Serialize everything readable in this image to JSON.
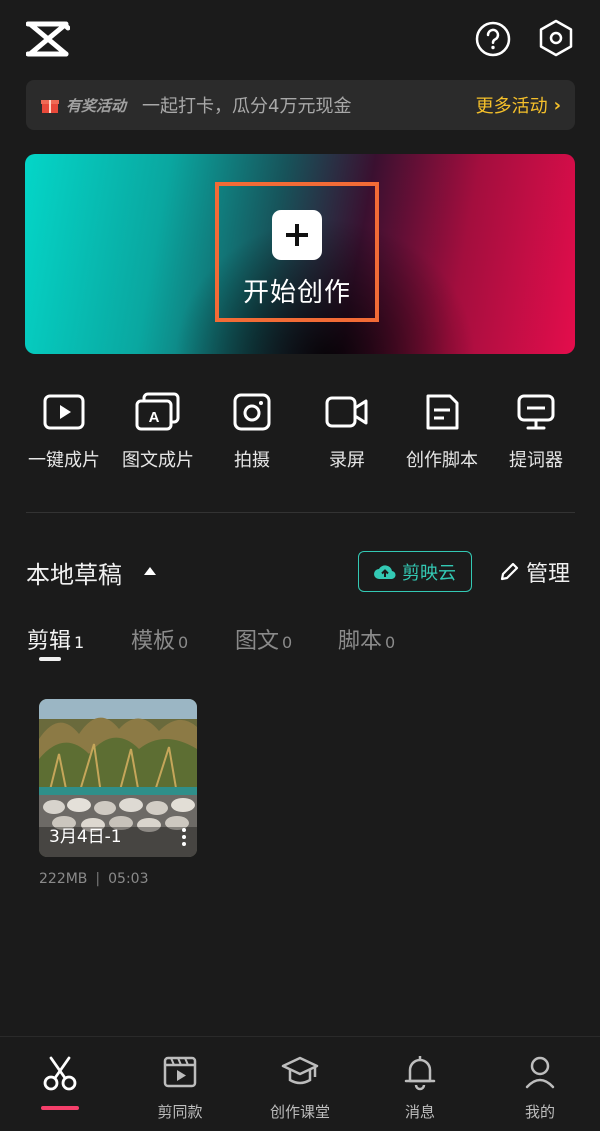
{
  "app": {
    "logo_icon": "capcut-logo-icon",
    "help_icon": "help-icon",
    "settings_icon": "settings-hex-icon"
  },
  "promo": {
    "tag": "有奖活动",
    "text": "一起打卡，瓜分4万元现金",
    "more_label": "更多活动",
    "more_color": "#f5c02a"
  },
  "create": {
    "label": "开始创作",
    "highlight_color": "#f26b36"
  },
  "tools": [
    {
      "label": "一键成片",
      "icon": "play-square-icon"
    },
    {
      "label": "图文成片",
      "icon": "text-card-icon"
    },
    {
      "label": "拍摄",
      "icon": "camera-icon"
    },
    {
      "label": "录屏",
      "icon": "video-camera-icon"
    },
    {
      "label": "创作脚本",
      "icon": "script-doc-icon"
    },
    {
      "label": "提词器",
      "icon": "teleprompter-icon"
    }
  ],
  "drafts": {
    "title": "本地草稿",
    "cloud_label": "剪映云",
    "cloud_color": "#33c9b4",
    "manage_label": "管理",
    "tabs": [
      {
        "label": "剪辑",
        "count": "1",
        "active": true
      },
      {
        "label": "模板",
        "count": "0",
        "active": false
      },
      {
        "label": "图文",
        "count": "0",
        "active": false
      },
      {
        "label": "脚本",
        "count": "0",
        "active": false
      }
    ],
    "items": [
      {
        "name": "3月4日-1",
        "size": "222MB",
        "duration": "05:03"
      }
    ]
  },
  "bottom_nav": {
    "items": [
      {
        "label": "",
        "icon": "scissors-icon",
        "active": true
      },
      {
        "label": "剪同款",
        "icon": "clapperboard-icon"
      },
      {
        "label": "创作课堂",
        "icon": "graduation-cap-icon"
      },
      {
        "label": "消息",
        "icon": "bell-icon"
      },
      {
        "label": "我的",
        "icon": "person-icon"
      }
    ],
    "active_color": "#f43f6a"
  }
}
